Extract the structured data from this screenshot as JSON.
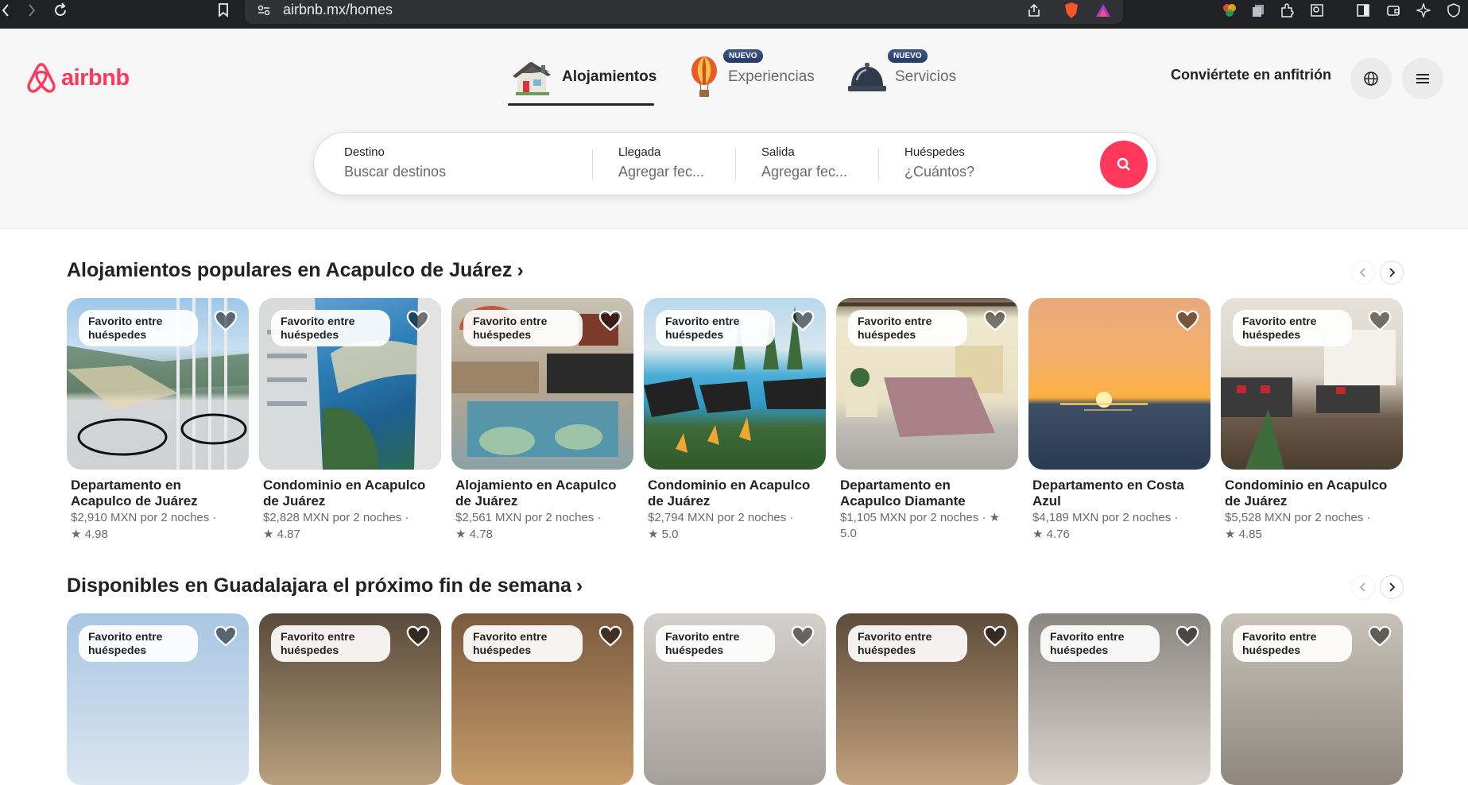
{
  "browser": {
    "url": "airbnb.mx/homes"
  },
  "header": {
    "brand": "airbnb",
    "tabs": [
      {
        "label": "Alojamientos",
        "active": true,
        "badge": ""
      },
      {
        "label": "Experiencias",
        "active": false,
        "badge": "NUEVO"
      },
      {
        "label": "Servicios",
        "active": false,
        "badge": "NUEVO"
      }
    ],
    "host_link": "Conviértete en anfitrión"
  },
  "search": {
    "destino": {
      "label": "Destino",
      "value": "Buscar destinos"
    },
    "llegada": {
      "label": "Llegada",
      "value": "Agregar fec..."
    },
    "salida": {
      "label": "Salida",
      "value": "Agregar fec..."
    },
    "huespedes": {
      "label": "Huéspedes",
      "value": "¿Cuántos?"
    }
  },
  "colors": {
    "brand": "#ff385c",
    "text": "#222222",
    "muted": "#6a6a6a"
  },
  "sections": [
    {
      "title": "Alojamientos populares en Acapulco de Juárez",
      "chevron": "›",
      "cards": [
        {
          "badge": "Favorito entre huéspedes",
          "title": "Departamento en Acapulco de Juárez",
          "price": "$2,910 MXN por 2 noches ·",
          "rating": "★ 4.98",
          "image": "balcony-ocean"
        },
        {
          "badge": "Favorito entre huéspedes",
          "title": "Condominio en Acapulco de Juárez",
          "price": "$2,828 MXN por 2 noches ·",
          "rating": "★ 4.87",
          "image": "aerial-bay"
        },
        {
          "badge": "Favorito entre huéspedes",
          "title": "Alojamiento en Acapulco de Juárez",
          "price": "$2,561 MXN por 2 noches ·",
          "rating": "★ 4.78",
          "image": "living-room"
        },
        {
          "badge": "Favorito entre huéspedes",
          "title": "Condominio en Acapulco de Juárez",
          "price": "$2,794 MXN por 2 noches ·",
          "rating": "★ 5.0",
          "image": "pool"
        },
        {
          "badge": "Favorito entre huéspedes",
          "title": "Departamento en Acapulco Diamante",
          "price": "$1,105 MXN por 2 noches · ★ 5.0",
          "rating": "",
          "image": "bedroom"
        },
        {
          "badge": "",
          "title": "Departamento en Costa Azul",
          "price": "$4,189 MXN por 2 noches ·",
          "rating": "★ 4.76",
          "image": "sunset"
        },
        {
          "badge": "Favorito entre huéspedes",
          "title": "Condominio en Acapulco de Juárez",
          "price": "$5,528 MXN por 2 noches ·",
          "rating": "★ 4.85",
          "image": "lounge"
        }
      ]
    },
    {
      "title": "Disponibles en Guadalajara el próximo fin de semana",
      "chevron": "›",
      "cards": [
        {
          "badge": "Favorito entre huéspedes",
          "image": "gdl-1"
        },
        {
          "badge": "Favorito entre huéspedes",
          "image": "gdl-2"
        },
        {
          "badge": "Favorito entre huéspedes",
          "image": "gdl-3"
        },
        {
          "badge": "Favorito entre huéspedes",
          "image": "gdl-4"
        },
        {
          "badge": "Favorito entre huéspedes",
          "image": "gdl-5"
        },
        {
          "badge": "Favorito entre huéspedes",
          "image": "gdl-6"
        },
        {
          "badge": "Favorito entre huéspedes",
          "image": "gdl-7"
        }
      ]
    }
  ]
}
